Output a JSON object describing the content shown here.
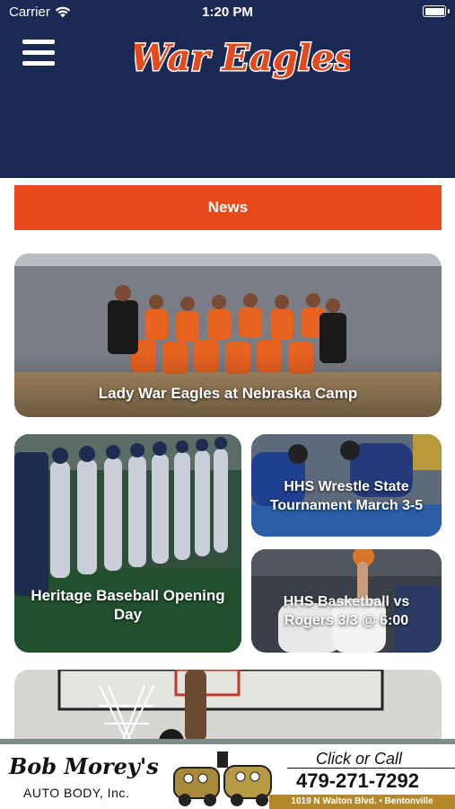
{
  "status_bar": {
    "carrier": "Carrier",
    "time": "1:20 PM"
  },
  "header": {
    "title": "War Eagles",
    "colors": {
      "background": "#1b2a55",
      "title": "#e8491b"
    }
  },
  "news_bar": {
    "label": "News",
    "color": "#e8491b"
  },
  "cards": [
    {
      "caption": "Lady War Eagles at Nebraska Camp"
    },
    {
      "caption": "Heritage Baseball Opening Day"
    },
    {
      "caption": "HHS Wrestle State Tournament March 3-5"
    },
    {
      "caption": "HHS Basketball vs Rogers 3/3 @ 6:00"
    }
  ],
  "ad": {
    "name": "Bob Morey's",
    "subtitle": "AUTO BODY, Inc.",
    "cta": "Click or Call",
    "phone": "479-271-7292",
    "address": "1019 N Walton Blvd. • Bentonville"
  },
  "icons": [
    "wifi-icon",
    "battery-icon",
    "hamburger-menu-icon"
  ]
}
